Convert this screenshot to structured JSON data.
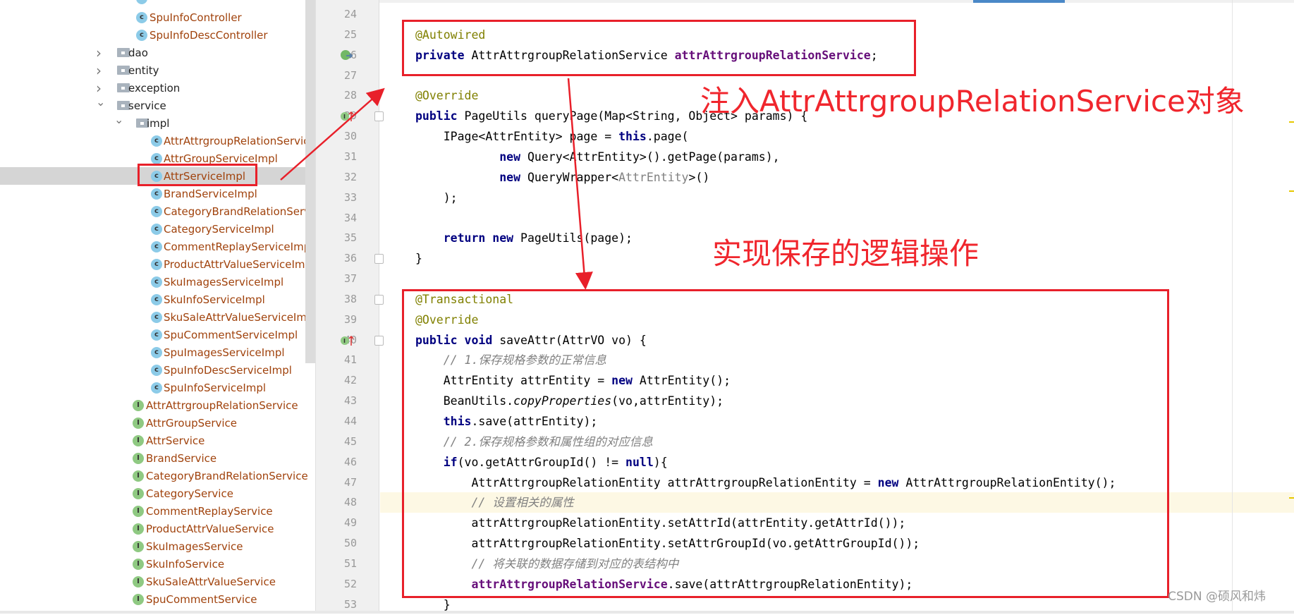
{
  "sidebar": {
    "items": [
      {
        "label": "SpuInfoController",
        "type": "class",
        "level": "ctrl"
      },
      {
        "label": "SpuInfoDescController",
        "type": "class",
        "level": "ctrl"
      },
      {
        "label": "dao",
        "type": "package",
        "level": "pkg",
        "state": "collapsed"
      },
      {
        "label": "entity",
        "type": "package",
        "level": "pkg",
        "state": "collapsed"
      },
      {
        "label": "exception",
        "type": "package",
        "level": "pkg",
        "state": "collapsed"
      },
      {
        "label": "service",
        "type": "package",
        "level": "pkg",
        "state": "expanded"
      },
      {
        "label": "impl",
        "type": "package",
        "level": "sub",
        "state": "expanded"
      },
      {
        "label": "AttrAttrgroupRelationServiceImpl",
        "type": "class",
        "level": "impl"
      },
      {
        "label": "AttrGroupServiceImpl",
        "type": "class",
        "level": "impl"
      },
      {
        "label": "AttrServiceImpl",
        "type": "class",
        "level": "impl",
        "selected": true
      },
      {
        "label": "BrandServiceImpl",
        "type": "class",
        "level": "impl"
      },
      {
        "label": "CategoryBrandRelationServiceImpl",
        "type": "class",
        "level": "impl"
      },
      {
        "label": "CategoryServiceImpl",
        "type": "class",
        "level": "impl"
      },
      {
        "label": "CommentReplayServiceImpl",
        "type": "class",
        "level": "impl"
      },
      {
        "label": "ProductAttrValueServiceImpl",
        "type": "class",
        "level": "impl"
      },
      {
        "label": "SkuImagesServiceImpl",
        "type": "class",
        "level": "impl"
      },
      {
        "label": "SkuInfoServiceImpl",
        "type": "class",
        "level": "impl"
      },
      {
        "label": "SkuSaleAttrValueServiceImpl",
        "type": "class",
        "level": "impl"
      },
      {
        "label": "SpuCommentServiceImpl",
        "type": "class",
        "level": "impl"
      },
      {
        "label": "SpuImagesServiceImpl",
        "type": "class",
        "level": "impl"
      },
      {
        "label": "SpuInfoDescServiceImpl",
        "type": "class",
        "level": "impl"
      },
      {
        "label": "SpuInfoServiceImpl",
        "type": "class",
        "level": "impl"
      },
      {
        "label": "AttrAttrgroupRelationService",
        "type": "interface",
        "level": "svc"
      },
      {
        "label": "AttrGroupService",
        "type": "interface",
        "level": "svc"
      },
      {
        "label": "AttrService",
        "type": "interface",
        "level": "svc"
      },
      {
        "label": "BrandService",
        "type": "interface",
        "level": "svc"
      },
      {
        "label": "CategoryBrandRelationService",
        "type": "interface",
        "level": "svc"
      },
      {
        "label": "CategoryService",
        "type": "interface",
        "level": "svc"
      },
      {
        "label": "CommentReplayService",
        "type": "interface",
        "level": "svc"
      },
      {
        "label": "ProductAttrValueService",
        "type": "interface",
        "level": "svc"
      },
      {
        "label": "SkuImagesService",
        "type": "interface",
        "level": "svc"
      },
      {
        "label": "SkuInfoService",
        "type": "interface",
        "level": "svc"
      },
      {
        "label": "SkuSaleAttrValueService",
        "type": "interface",
        "level": "svc"
      },
      {
        "label": "SpuCommentService",
        "type": "interface",
        "level": "svc"
      }
    ]
  },
  "editor": {
    "highlighted_line": 48,
    "lines": [
      {
        "n": "24",
        "segs": []
      },
      {
        "n": "25",
        "segs": [
          {
            "t": "@Autowired",
            "c": "an"
          }
        ]
      },
      {
        "n": "26",
        "segs": [
          {
            "t": "private ",
            "c": "kw"
          },
          {
            "t": "AttrAttrgroupRelationService ",
            "c": ""
          },
          {
            "t": "attrAttrgroupRelationService",
            "c": "fd"
          },
          {
            "t": ";",
            "c": ""
          }
        ]
      },
      {
        "n": "27",
        "segs": []
      },
      {
        "n": "28",
        "segs": [
          {
            "t": "@Override",
            "c": "an"
          }
        ]
      },
      {
        "n": "29",
        "segs": [
          {
            "t": "public ",
            "c": "kw"
          },
          {
            "t": "PageUtils queryPage(Map<String, Object> params) {",
            "c": ""
          }
        ]
      },
      {
        "n": "30",
        "segs": [
          {
            "t": "    IPage<AttrEntity> page = ",
            "c": ""
          },
          {
            "t": "this",
            "c": "kw"
          },
          {
            "t": ".page(",
            "c": ""
          }
        ]
      },
      {
        "n": "31",
        "segs": [
          {
            "t": "            ",
            "c": ""
          },
          {
            "t": "new ",
            "c": "kw"
          },
          {
            "t": "Query<AttrEntity>().getPage(params),",
            "c": ""
          }
        ]
      },
      {
        "n": "32",
        "segs": [
          {
            "t": "            ",
            "c": ""
          },
          {
            "t": "new ",
            "c": "kw"
          },
          {
            "t": "QueryWrapper<",
            "c": ""
          },
          {
            "t": "AttrEntity",
            "c": "gt"
          },
          {
            "t": ">()",
            "c": ""
          }
        ]
      },
      {
        "n": "33",
        "segs": [
          {
            "t": "    );",
            "c": ""
          }
        ]
      },
      {
        "n": "34",
        "segs": []
      },
      {
        "n": "35",
        "segs": [
          {
            "t": "    ",
            "c": ""
          },
          {
            "t": "return new ",
            "c": "kw"
          },
          {
            "t": "PageUtils(page);",
            "c": ""
          }
        ]
      },
      {
        "n": "36",
        "segs": [
          {
            "t": "}",
            "c": ""
          }
        ]
      },
      {
        "n": "37",
        "segs": []
      },
      {
        "n": "38",
        "segs": [
          {
            "t": "@Transactional",
            "c": "an"
          }
        ]
      },
      {
        "n": "39",
        "segs": [
          {
            "t": "@Override",
            "c": "an"
          }
        ]
      },
      {
        "n": "40",
        "segs": [
          {
            "t": "public void ",
            "c": "kw"
          },
          {
            "t": "saveAttr(AttrVO vo) {",
            "c": ""
          }
        ]
      },
      {
        "n": "41",
        "segs": [
          {
            "t": "    ",
            "c": ""
          },
          {
            "t": "// 1.保存规格参数的正常信息",
            "c": "cm"
          }
        ]
      },
      {
        "n": "42",
        "segs": [
          {
            "t": "    AttrEntity attrEntity = ",
            "c": ""
          },
          {
            "t": "new ",
            "c": "kw"
          },
          {
            "t": "AttrEntity();",
            "c": ""
          }
        ]
      },
      {
        "n": "43",
        "segs": [
          {
            "t": "    BeanUtils.",
            "c": ""
          },
          {
            "t": "copyProperties",
            "c": "st"
          },
          {
            "t": "(vo,attrEntity);",
            "c": ""
          }
        ]
      },
      {
        "n": "44",
        "segs": [
          {
            "t": "    ",
            "c": ""
          },
          {
            "t": "this",
            "c": "kw"
          },
          {
            "t": ".save(attrEntity);",
            "c": ""
          }
        ]
      },
      {
        "n": "45",
        "segs": [
          {
            "t": "    ",
            "c": ""
          },
          {
            "t": "// 2.保存规格参数和属性组的对应信息",
            "c": "cm"
          }
        ]
      },
      {
        "n": "46",
        "segs": [
          {
            "t": "    ",
            "c": ""
          },
          {
            "t": "if",
            "c": "kw"
          },
          {
            "t": "(vo.getAttrGroupId() != ",
            "c": ""
          },
          {
            "t": "null",
            "c": "kw"
          },
          {
            "t": "){",
            "c": ""
          }
        ]
      },
      {
        "n": "47",
        "segs": [
          {
            "t": "        AttrAttrgroupRelationEntity attrAttrgroupRelationEntity = ",
            "c": ""
          },
          {
            "t": "new ",
            "c": "kw"
          },
          {
            "t": "AttrAttrgroupRelationEntity();",
            "c": ""
          }
        ]
      },
      {
        "n": "48",
        "segs": [
          {
            "t": "        ",
            "c": ""
          },
          {
            "t": "// 设置相关的属性",
            "c": "cm"
          }
        ]
      },
      {
        "n": "49",
        "segs": [
          {
            "t": "        attrAttrgroupRelationEntity.setAttrId(attrEntity.getAttrId());",
            "c": ""
          }
        ]
      },
      {
        "n": "50",
        "segs": [
          {
            "t": "        attrAttrgroupRelationEntity.setAttrGroupId(vo.getAttrGroupId());",
            "c": ""
          }
        ]
      },
      {
        "n": "51",
        "segs": [
          {
            "t": "        ",
            "c": ""
          },
          {
            "t": "// 将关联的数据存储到对应的表结构中",
            "c": "cm"
          }
        ]
      },
      {
        "n": "52",
        "segs": [
          {
            "t": "        ",
            "c": ""
          },
          {
            "t": "attrAttrgroupRelationService",
            "c": "fd"
          },
          {
            "t": ".save(attrAttrgroupRelationEntity);",
            "c": ""
          }
        ]
      },
      {
        "n": "53",
        "segs": [
          {
            "t": "    }",
            "c": ""
          }
        ]
      }
    ]
  },
  "annotations": {
    "inject_note": "注入AttrAttrgroupRelationService对象",
    "save_note": "实现保存的逻辑操作",
    "color": "#e8202a"
  },
  "watermark": "CSDN @硕风和炜"
}
